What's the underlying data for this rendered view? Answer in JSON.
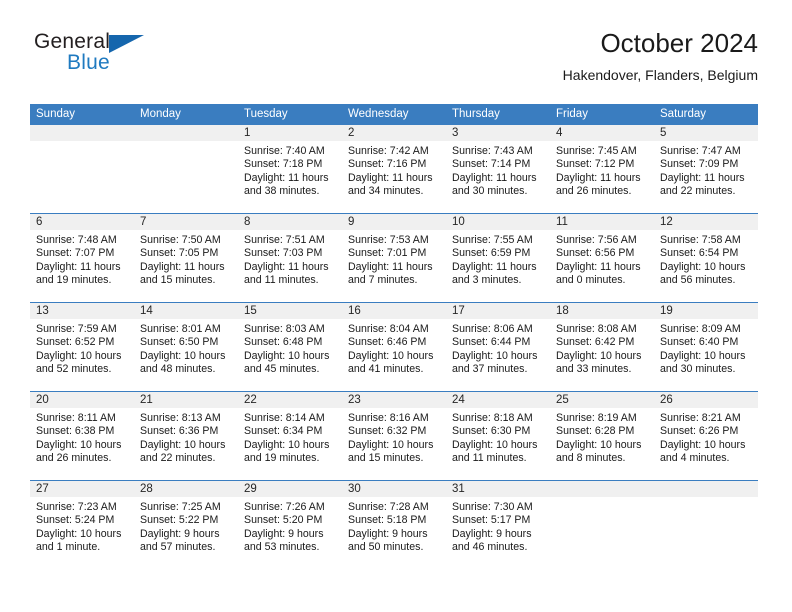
{
  "brand": {
    "name_part1": "General",
    "name_part2": "Blue",
    "flag_icon": "triangle-flag-icon"
  },
  "header": {
    "title": "October 2024",
    "subtitle": "Hakendover, Flanders, Belgium"
  },
  "colors": {
    "header_blue": "#3a7dc0",
    "brand_blue": "#1f7ac0",
    "flag_blue": "#1566ad",
    "daynum_band": "#f0f0f0",
    "text": "#1a1a1a"
  },
  "calendar": {
    "weekday_headers": [
      "Sunday",
      "Monday",
      "Tuesday",
      "Wednesday",
      "Thursday",
      "Friday",
      "Saturday"
    ],
    "labels": {
      "sunrise": "Sunrise:",
      "sunset": "Sunset:",
      "daylight": "Daylight:"
    },
    "weeks": [
      [
        {
          "day": "",
          "lines": []
        },
        {
          "day": "",
          "lines": []
        },
        {
          "day": "1",
          "lines": [
            "Sunrise: 7:40 AM",
            "Sunset: 7:18 PM",
            "Daylight: 11 hours",
            "and 38 minutes."
          ]
        },
        {
          "day": "2",
          "lines": [
            "Sunrise: 7:42 AM",
            "Sunset: 7:16 PM",
            "Daylight: 11 hours",
            "and 34 minutes."
          ]
        },
        {
          "day": "3",
          "lines": [
            "Sunrise: 7:43 AM",
            "Sunset: 7:14 PM",
            "Daylight: 11 hours",
            "and 30 minutes."
          ]
        },
        {
          "day": "4",
          "lines": [
            "Sunrise: 7:45 AM",
            "Sunset: 7:12 PM",
            "Daylight: 11 hours",
            "and 26 minutes."
          ]
        },
        {
          "day": "5",
          "lines": [
            "Sunrise: 7:47 AM",
            "Sunset: 7:09 PM",
            "Daylight: 11 hours",
            "and 22 minutes."
          ]
        }
      ],
      [
        {
          "day": "6",
          "lines": [
            "Sunrise: 7:48 AM",
            "Sunset: 7:07 PM",
            "Daylight: 11 hours",
            "and 19 minutes."
          ]
        },
        {
          "day": "7",
          "lines": [
            "Sunrise: 7:50 AM",
            "Sunset: 7:05 PM",
            "Daylight: 11 hours",
            "and 15 minutes."
          ]
        },
        {
          "day": "8",
          "lines": [
            "Sunrise: 7:51 AM",
            "Sunset: 7:03 PM",
            "Daylight: 11 hours",
            "and 11 minutes."
          ]
        },
        {
          "day": "9",
          "lines": [
            "Sunrise: 7:53 AM",
            "Sunset: 7:01 PM",
            "Daylight: 11 hours",
            "and 7 minutes."
          ]
        },
        {
          "day": "10",
          "lines": [
            "Sunrise: 7:55 AM",
            "Sunset: 6:59 PM",
            "Daylight: 11 hours",
            "and 3 minutes."
          ]
        },
        {
          "day": "11",
          "lines": [
            "Sunrise: 7:56 AM",
            "Sunset: 6:56 PM",
            "Daylight: 11 hours",
            "and 0 minutes."
          ]
        },
        {
          "day": "12",
          "lines": [
            "Sunrise: 7:58 AM",
            "Sunset: 6:54 PM",
            "Daylight: 10 hours",
            "and 56 minutes."
          ]
        }
      ],
      [
        {
          "day": "13",
          "lines": [
            "Sunrise: 7:59 AM",
            "Sunset: 6:52 PM",
            "Daylight: 10 hours",
            "and 52 minutes."
          ]
        },
        {
          "day": "14",
          "lines": [
            "Sunrise: 8:01 AM",
            "Sunset: 6:50 PM",
            "Daylight: 10 hours",
            "and 48 minutes."
          ]
        },
        {
          "day": "15",
          "lines": [
            "Sunrise: 8:03 AM",
            "Sunset: 6:48 PM",
            "Daylight: 10 hours",
            "and 45 minutes."
          ]
        },
        {
          "day": "16",
          "lines": [
            "Sunrise: 8:04 AM",
            "Sunset: 6:46 PM",
            "Daylight: 10 hours",
            "and 41 minutes."
          ]
        },
        {
          "day": "17",
          "lines": [
            "Sunrise: 8:06 AM",
            "Sunset: 6:44 PM",
            "Daylight: 10 hours",
            "and 37 minutes."
          ]
        },
        {
          "day": "18",
          "lines": [
            "Sunrise: 8:08 AM",
            "Sunset: 6:42 PM",
            "Daylight: 10 hours",
            "and 33 minutes."
          ]
        },
        {
          "day": "19",
          "lines": [
            "Sunrise: 8:09 AM",
            "Sunset: 6:40 PM",
            "Daylight: 10 hours",
            "and 30 minutes."
          ]
        }
      ],
      [
        {
          "day": "20",
          "lines": [
            "Sunrise: 8:11 AM",
            "Sunset: 6:38 PM",
            "Daylight: 10 hours",
            "and 26 minutes."
          ]
        },
        {
          "day": "21",
          "lines": [
            "Sunrise: 8:13 AM",
            "Sunset: 6:36 PM",
            "Daylight: 10 hours",
            "and 22 minutes."
          ]
        },
        {
          "day": "22",
          "lines": [
            "Sunrise: 8:14 AM",
            "Sunset: 6:34 PM",
            "Daylight: 10 hours",
            "and 19 minutes."
          ]
        },
        {
          "day": "23",
          "lines": [
            "Sunrise: 8:16 AM",
            "Sunset: 6:32 PM",
            "Daylight: 10 hours",
            "and 15 minutes."
          ]
        },
        {
          "day": "24",
          "lines": [
            "Sunrise: 8:18 AM",
            "Sunset: 6:30 PM",
            "Daylight: 10 hours",
            "and 11 minutes."
          ]
        },
        {
          "day": "25",
          "lines": [
            "Sunrise: 8:19 AM",
            "Sunset: 6:28 PM",
            "Daylight: 10 hours",
            "and 8 minutes."
          ]
        },
        {
          "day": "26",
          "lines": [
            "Sunrise: 8:21 AM",
            "Sunset: 6:26 PM",
            "Daylight: 10 hours",
            "and 4 minutes."
          ]
        }
      ],
      [
        {
          "day": "27",
          "lines": [
            "Sunrise: 7:23 AM",
            "Sunset: 5:24 PM",
            "Daylight: 10 hours",
            "and 1 minute."
          ]
        },
        {
          "day": "28",
          "lines": [
            "Sunrise: 7:25 AM",
            "Sunset: 5:22 PM",
            "Daylight: 9 hours",
            "and 57 minutes."
          ]
        },
        {
          "day": "29",
          "lines": [
            "Sunrise: 7:26 AM",
            "Sunset: 5:20 PM",
            "Daylight: 9 hours",
            "and 53 minutes."
          ]
        },
        {
          "day": "30",
          "lines": [
            "Sunrise: 7:28 AM",
            "Sunset: 5:18 PM",
            "Daylight: 9 hours",
            "and 50 minutes."
          ]
        },
        {
          "day": "31",
          "lines": [
            "Sunrise: 7:30 AM",
            "Sunset: 5:17 PM",
            "Daylight: 9 hours",
            "and 46 minutes."
          ]
        },
        {
          "day": "",
          "lines": []
        },
        {
          "day": "",
          "lines": []
        }
      ]
    ]
  }
}
